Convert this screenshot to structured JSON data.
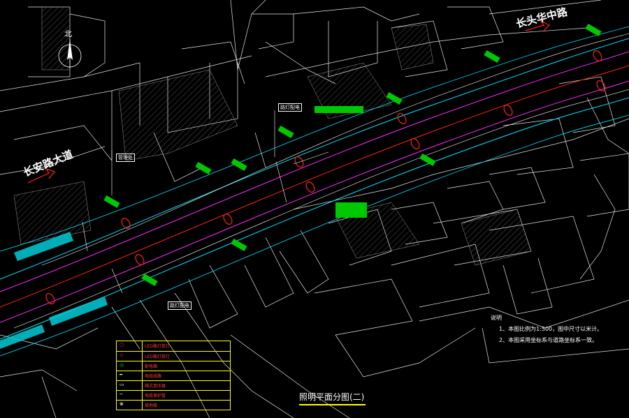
{
  "drawing": {
    "title": "照明平面分图(二)",
    "north_label": "北",
    "road_names": {
      "left": "长安路大道",
      "top_right": "长头华中路"
    },
    "callouts": {
      "upper": "路灯配电",
      "left": "管理处",
      "lower": "路灯配电"
    },
    "notes": {
      "heading": "说明",
      "items": [
        "1、本图比例为1:500，图中尺寸以米计。",
        "2、本图采用坐标系与道路坐标系一致。"
      ]
    },
    "legend": {
      "rows": [
        {
          "symbol": "○",
          "text": "LED路灯单灯"
        },
        {
          "symbol": "◇",
          "text": "LED路灯双灯"
        },
        {
          "symbol": "◎",
          "text": "配电箱"
        },
        {
          "symbol": "━",
          "text": "电缆线路"
        },
        {
          "symbol": "▭",
          "text": "箱式变压器"
        },
        {
          "symbol": "─",
          "text": "电缆保护管"
        },
        {
          "symbol": "⊗",
          "text": "接地极"
        }
      ]
    },
    "colors": {
      "background": "#000000",
      "building": "#ffffff",
      "cyan": "#00e5ff",
      "magenta": "#ff2bff",
      "red": "#ff2020",
      "green": "#00c800",
      "yellow": "#ffff00"
    }
  }
}
